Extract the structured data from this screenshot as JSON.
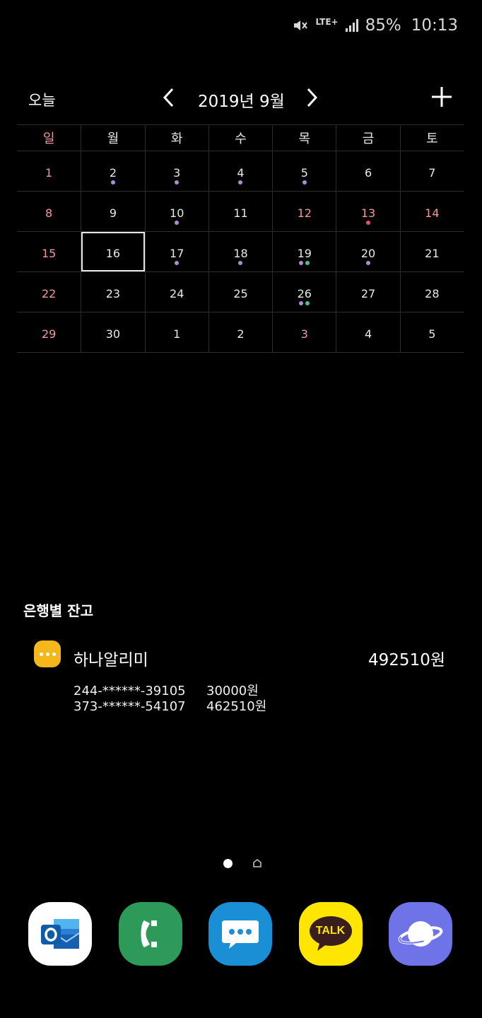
{
  "status_bar": {
    "network": "LTE+",
    "battery": "85%",
    "time": "10:13",
    "icons": [
      "mute-icon",
      "signal-icon"
    ]
  },
  "calendar": {
    "today_label": "오늘",
    "month_label": "2019년 9월",
    "weekdays": [
      "일",
      "월",
      "화",
      "수",
      "목",
      "금",
      "토"
    ],
    "weeks": [
      [
        "1",
        "2",
        "3",
        "4",
        "5",
        "6",
        "7"
      ],
      [
        "8",
        "9",
        "10",
        "11",
        "12",
        "13",
        "14"
      ],
      [
        "15",
        "16",
        "17",
        "18",
        "19",
        "20",
        "21"
      ],
      [
        "22",
        "23",
        "24",
        "25",
        "26",
        "27",
        "28"
      ],
      [
        "29",
        "30",
        "1",
        "2",
        "3",
        "4",
        "5"
      ]
    ],
    "selected_day": "16",
    "colors": {
      "holiday": "#f09aa0",
      "event_purple": "#b08ad8",
      "event_green": "#4cc08a",
      "event_red": "#e8506a"
    }
  },
  "bank_widget": {
    "title": "은행별 잔고",
    "app_name": "하나알리미",
    "total": "492510원",
    "accounts": [
      {
        "number": "244-******-39105",
        "balance": "30000원"
      },
      {
        "number": "373-******-54107",
        "balance": "462510원"
      }
    ],
    "icon_color": "#f5b81a"
  },
  "dock": {
    "apps": [
      {
        "icon": "outlook-icon",
        "color": "#ffffff"
      },
      {
        "icon": "phone-icon",
        "color": "#2e9a5a"
      },
      {
        "icon": "messages-icon",
        "color": "#1a8fd6"
      },
      {
        "icon": "kakaotalk-icon",
        "color": "#ffe600",
        "label": "TALK"
      },
      {
        "icon": "internet-icon",
        "color": "#6e73e8"
      }
    ]
  }
}
